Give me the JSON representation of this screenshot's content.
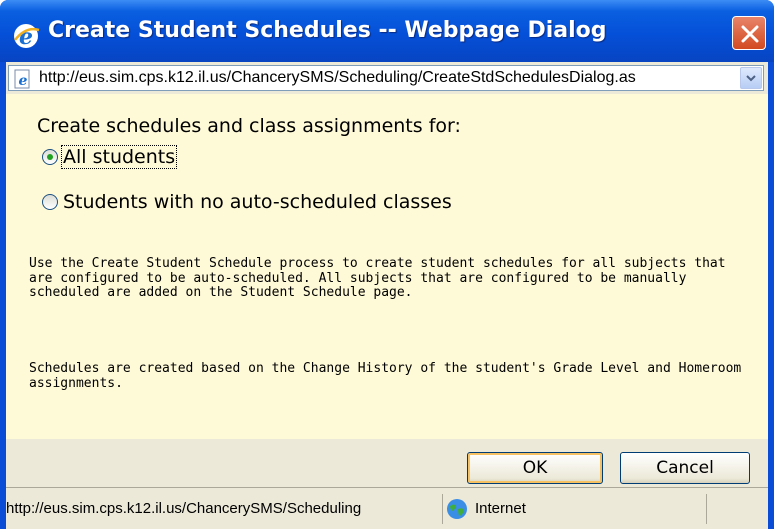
{
  "window": {
    "title": "Create Student Schedules -- Webpage Dialog",
    "address": "http://eus.sim.cps.k12.il.us/ChancerySMS/Scheduling/CreateStdSchedulesDialog.as",
    "title_icon": "ie-icon",
    "close_icon": "close-icon"
  },
  "content": {
    "prompt": "Create schedules and class assignments for:",
    "options": [
      {
        "label": "All students",
        "selected": true
      },
      {
        "label": "Students with no auto-scheduled classes",
        "selected": false
      }
    ],
    "description_1": "Use the Create Student Schedule process to create student schedules for all subjects that are configured to be auto-scheduled. All subjects that are configured to be manually scheduled are added on the Student Schedule page.",
    "description_2": "Schedules are created based on the Change History of the student's Grade Level and Homeroom assignments."
  },
  "buttons": {
    "ok_label": "OK",
    "cancel_label": "Cancel"
  },
  "statusbar": {
    "url": "http://eus.sim.cps.k12.il.us/ChancerySMS/Scheduling",
    "zone": "Internet",
    "zone_icon": "globe-icon"
  },
  "colors": {
    "title_bar": "#0550d8",
    "content_bg": "#fef9d7",
    "chrome_bg": "#ece9d8",
    "close_button": "#d24a20"
  }
}
